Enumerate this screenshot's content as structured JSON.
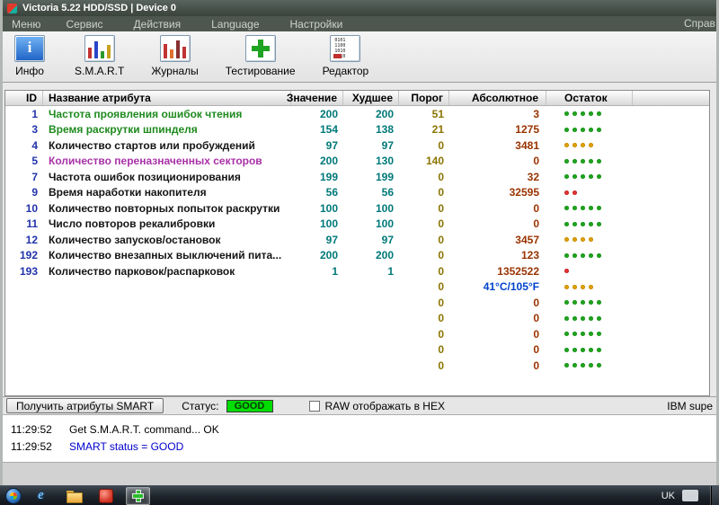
{
  "window": {
    "title": "Victoria 5.22 HDD/SSD | Device 0",
    "menu": {
      "items": [
        "Меню",
        "Сервис",
        "Действия",
        "Language",
        "Настройки"
      ],
      "help": "Справ"
    }
  },
  "toolbar": {
    "buttons": [
      {
        "label": "Инфо",
        "icon": "info"
      },
      {
        "label": "S.M.A.R.T",
        "icon": "smart"
      },
      {
        "label": "Журналы",
        "icon": "logs"
      },
      {
        "label": "Тестирование",
        "icon": "test"
      },
      {
        "label": "Редактор",
        "icon": "editor"
      }
    ]
  },
  "table": {
    "columns": [
      "ID",
      "Название атрибута",
      "Значение",
      "Худшее",
      "Порог",
      "Абсолютное",
      "Остаток"
    ],
    "rows": [
      {
        "id": "1",
        "name": "Частота проявления ошибок чтения",
        "name_color": "green",
        "value": "200",
        "worst": "200",
        "threshold": "51",
        "raw": "3",
        "health": {
          "count": 5,
          "color": "green"
        }
      },
      {
        "id": "3",
        "name": "Время раскрутки шпинделя",
        "name_color": "green",
        "value": "154",
        "worst": "138",
        "threshold": "21",
        "raw": "1275",
        "health": {
          "count": 5,
          "color": "green"
        }
      },
      {
        "id": "4",
        "name": "Количество стартов или пробуждений",
        "name_color": "black",
        "value": "97",
        "worst": "97",
        "threshold": "0",
        "raw": "3481",
        "health": {
          "count": 4,
          "color": "yellow"
        }
      },
      {
        "id": "5",
        "name": "Количество переназначенных секторов",
        "name_color": "magenta",
        "value": "200",
        "worst": "130",
        "threshold": "140",
        "raw": "0",
        "health": {
          "count": 5,
          "color": "green"
        }
      },
      {
        "id": "7",
        "name": "Частота ошибок позиционирования",
        "name_color": "black",
        "value": "199",
        "worst": "199",
        "threshold": "0",
        "raw": "32",
        "health": {
          "count": 5,
          "color": "green"
        }
      },
      {
        "id": "9",
        "name": "Время наработки накопителя",
        "name_color": "black",
        "value": "56",
        "worst": "56",
        "threshold": "0",
        "raw": "32595",
        "health": {
          "count": 2,
          "color": "red"
        }
      },
      {
        "id": "10",
        "name": "Количество повторных попыток раскрутки",
        "name_color": "black",
        "value": "100",
        "worst": "100",
        "threshold": "0",
        "raw": "0",
        "health": {
          "count": 5,
          "color": "green"
        }
      },
      {
        "id": "11",
        "name": "Число повторов рекалибровки",
        "name_color": "black",
        "value": "100",
        "worst": "100",
        "threshold": "0",
        "raw": "0",
        "health": {
          "count": 5,
          "color": "green"
        }
      },
      {
        "id": "12",
        "name": "Количество запусков/остановок",
        "name_color": "black",
        "value": "97",
        "worst": "97",
        "threshold": "0",
        "raw": "3457",
        "health": {
          "count": 4,
          "color": "yellow"
        }
      },
      {
        "id": "192",
        "name": "Количество внезапных выключений пита...",
        "name_color": "black",
        "value": "200",
        "worst": "200",
        "threshold": "0",
        "raw": "123",
        "health": {
          "count": 5,
          "color": "green"
        }
      },
      {
        "id": "193",
        "name": "Количество парковок/распарковок",
        "name_color": "black",
        "value": "1",
        "worst": "1",
        "threshold": "0",
        "raw": "1352522",
        "health": {
          "count": 1,
          "color": "red"
        }
      },
      {
        "id": "",
        "name": "",
        "name_color": "black",
        "value": "",
        "worst": "",
        "threshold": "0",
        "raw": "41°C/105°F",
        "raw_color": "blue",
        "health": {
          "count": 4,
          "color": "yellow"
        }
      },
      {
        "id": "",
        "name": "",
        "name_color": "black",
        "value": "",
        "worst": "",
        "threshold": "0",
        "raw": "0",
        "health": {
          "count": 5,
          "color": "green"
        }
      },
      {
        "id": "",
        "name": "",
        "name_color": "black",
        "value": "",
        "worst": "",
        "threshold": "0",
        "raw": "0",
        "health": {
          "count": 5,
          "color": "green"
        }
      },
      {
        "id": "",
        "name": "",
        "name_color": "black",
        "value": "",
        "worst": "",
        "threshold": "0",
        "raw": "0",
        "health": {
          "count": 5,
          "color": "green"
        }
      },
      {
        "id": "",
        "name": "",
        "name_color": "black",
        "value": "",
        "worst": "",
        "threshold": "0",
        "raw": "0",
        "health": {
          "count": 5,
          "color": "green"
        }
      },
      {
        "id": "",
        "name": "",
        "name_color": "black",
        "value": "",
        "worst": "",
        "threshold": "0",
        "raw": "0",
        "health": {
          "count": 5,
          "color": "green"
        }
      }
    ]
  },
  "controls": {
    "get_button": "Получить атрибуты SMART",
    "status_label": "Статус:",
    "status_value": "GOOD",
    "status_color": "#00dd00",
    "raw_checkbox_label": "RAW отображать в HEX",
    "raw_checkbox_checked": false,
    "right_text": "IBM supe"
  },
  "log": {
    "lines": [
      {
        "time": "11:29:52",
        "text": "Get S.M.A.R.T. command... OK",
        "color": "black"
      },
      {
        "time": "11:29:52",
        "text": "SMART status = GOOD",
        "color": "blue"
      }
    ]
  },
  "taskbar": {
    "language": "UK",
    "icons": [
      {
        "name": "browser"
      },
      {
        "name": "explorer"
      },
      {
        "name": "player"
      },
      {
        "name": "victoria",
        "active": true
      }
    ]
  }
}
